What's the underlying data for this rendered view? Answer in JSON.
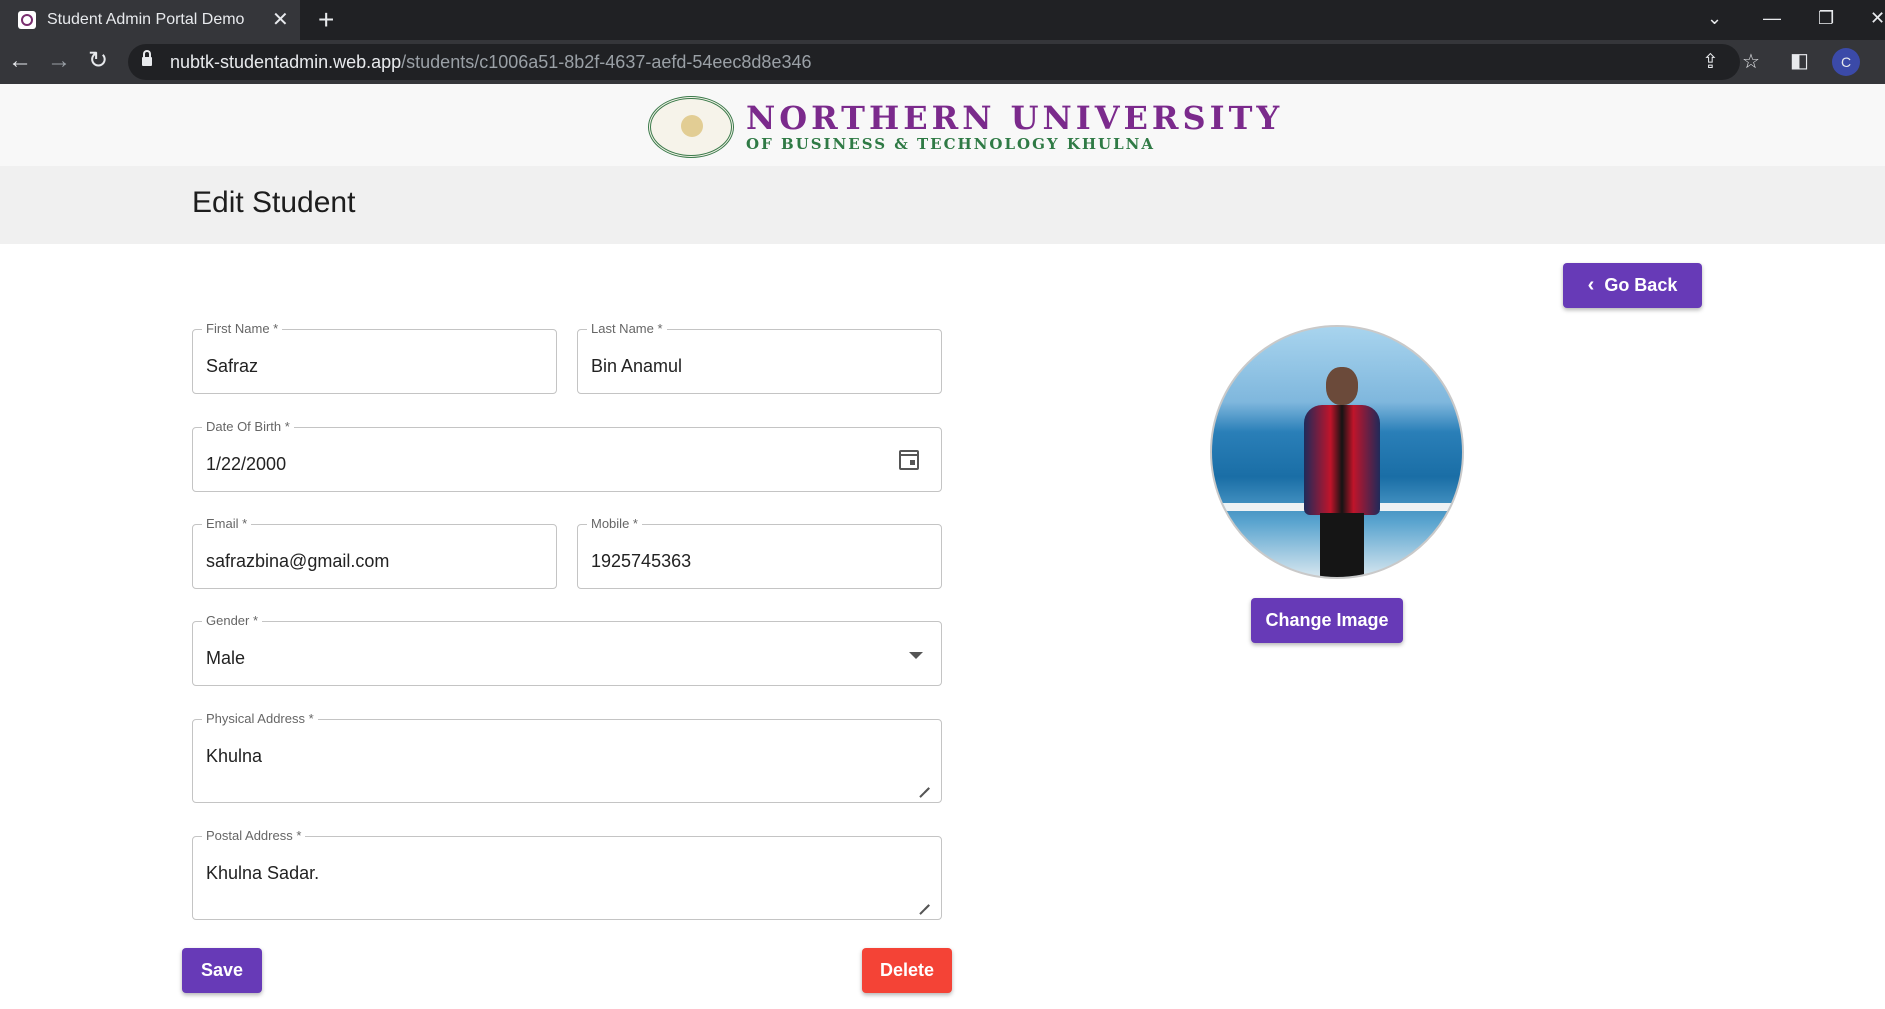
{
  "browser": {
    "tab_title": "Student Admin Portal Demo",
    "url_host": "nubtk-studentadmin.web.app",
    "url_path": "/students/c1006a51-8b2f-4637-aefd-54eec8d8e346",
    "profile_initial": "C"
  },
  "header": {
    "university_name": "NORTHERN UNIVERSITY",
    "university_subtitle": "OF BUSINESS & TECHNOLOGY KHULNA",
    "logo_primary_color": "#7b2a8c",
    "logo_secondary_color": "#2f7a45"
  },
  "page": {
    "title": "Edit Student",
    "go_back_label": "Go Back"
  },
  "form": {
    "first_name": {
      "label": "First Name *",
      "value": "Safraz"
    },
    "last_name": {
      "label": "Last Name *",
      "value": "Bin Anamul"
    },
    "date_of_birth": {
      "label": "Date Of Birth *",
      "value": "1/22/2000"
    },
    "email": {
      "label": "Email *",
      "value": "safrazbina@gmail.com"
    },
    "mobile": {
      "label": "Mobile *",
      "value": "1925745363"
    },
    "gender": {
      "label": "Gender *",
      "value": "Male"
    },
    "physical_address": {
      "label": "Physical Address *",
      "value": "Khulna"
    },
    "postal_address": {
      "label": "Postal Address *",
      "value": "Khulna Sadar."
    }
  },
  "profile_image": {
    "change_label": "Change Image"
  },
  "actions": {
    "save_label": "Save",
    "delete_label": "Delete",
    "primary_color": "#673ab7",
    "danger_color": "#f44336"
  }
}
